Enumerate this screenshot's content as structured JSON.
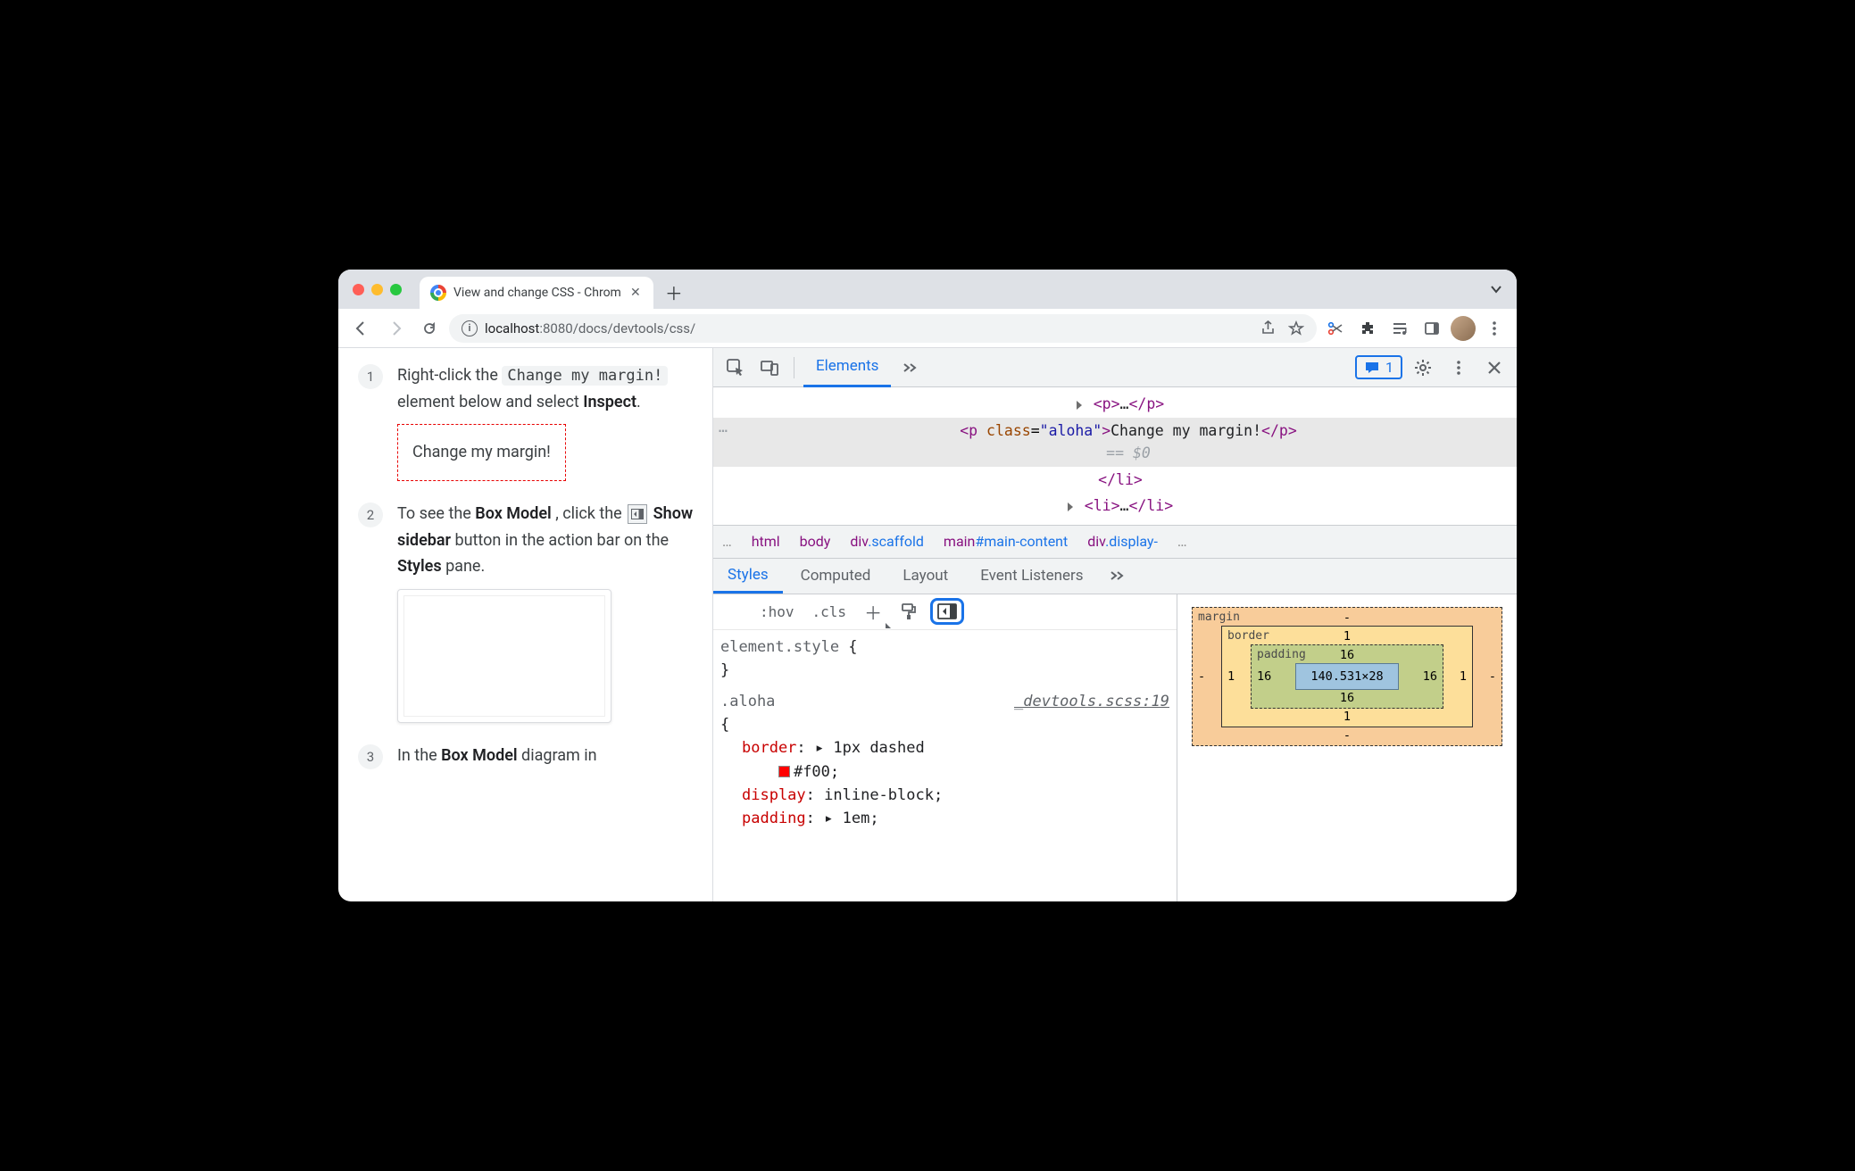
{
  "browser": {
    "tab_title": "View and change CSS - Chrom",
    "url_host": "localhost",
    "url_port": ":8080",
    "url_path": "/docs/devtools/css/"
  },
  "page": {
    "steps": [
      {
        "num": "1",
        "pre": "Right-click the ",
        "code": "Change my margin!",
        "mid": " element below and select ",
        "bold": "Inspect",
        "suffix": ".",
        "demo": "Change my margin!"
      },
      {
        "num": "2",
        "text_a": "To see the ",
        "bold_a": "Box Model",
        "text_b": ", click the ",
        "bold_b": "Show sidebar",
        "text_c": " button in the action bar on the ",
        "bold_c": "Styles",
        "text_d": " pane."
      },
      {
        "num": "3",
        "text_a": "In the ",
        "bold_a": "Box Model",
        "text_b": " diagram in"
      }
    ]
  },
  "devtools": {
    "tabs": {
      "elements": "Elements"
    },
    "issues_count": "1",
    "dom": {
      "line1_tag": "<p>",
      "line1_ell": "…",
      "line1_close": "</p>",
      "sel_open": "<p ",
      "sel_attr": "class",
      "sel_eq": "=",
      "sel_val": "\"aloha\"",
      "sel_gt": ">",
      "sel_text": "Change my margin!",
      "sel_close": "</p>",
      "sel_marker": "== $0",
      "li_close": "</li>",
      "li2_open": "<li>",
      "li2_ell": "…",
      "li2_close": "</li>"
    },
    "crumbs": {
      "c0": "…",
      "c1": "html",
      "c2": "body",
      "c3_a": "div",
      "c3_b": ".scaffold",
      "c4_a": "main",
      "c4_b": "#main-content",
      "c5_a": "div",
      "c5_b": ".display-",
      "c6": "…"
    },
    "subtabs": {
      "styles": "Styles",
      "computed": "Computed",
      "layout": "Layout",
      "listeners": "Event Listeners"
    },
    "styles_actions": {
      "hov": ":hov",
      "cls": ".cls"
    },
    "css": {
      "rule1_sel": "element.style ",
      "rule1_open": "{",
      "rule1_close": "}",
      "rule2_sel": ".aloha ",
      "rule2_src": "_devtools.scss:19",
      "rule2_open": "{",
      "p1_name": "border",
      "p1_sep": ": ▸ ",
      "p1_val_a": "1px dashed",
      "p1_val_b": "#f00",
      "p1_end": ";",
      "p2_name": "display",
      "p2_sep": ": ",
      "p2_val": "inline-block",
      "p2_end": ";",
      "p3_name": "padding",
      "p3_sep": ": ▸ ",
      "p3_val": "1em",
      "p3_end": ";"
    },
    "boxmodel": {
      "margin_label": "margin",
      "border_label": "border",
      "padding_label": "padding",
      "m_top": "-",
      "m_right": "-",
      "m_bottom": "-",
      "m_left": "-",
      "b_top": "1",
      "b_right": "1",
      "b_bottom": "1",
      "b_left": "1",
      "p_top": "16",
      "p_right": "16",
      "p_bottom": "16",
      "p_left": "16",
      "content": "140.531×28"
    }
  }
}
